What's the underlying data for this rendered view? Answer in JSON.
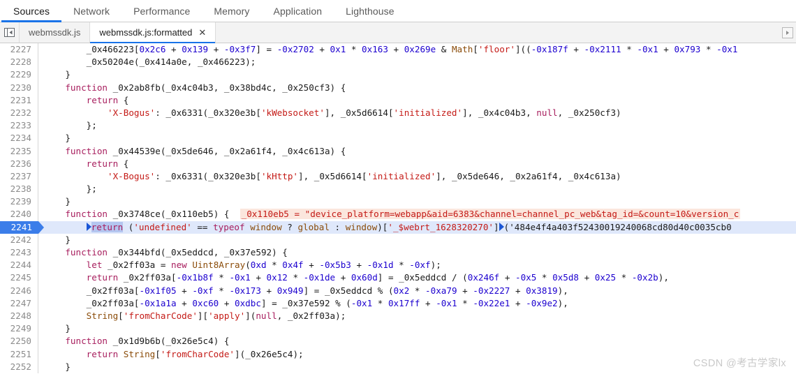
{
  "panel_tabs": [
    {
      "label": "Sources",
      "active": true
    },
    {
      "label": "Network",
      "active": false
    },
    {
      "label": "Performance",
      "active": false
    },
    {
      "label": "Memory",
      "active": false
    },
    {
      "label": "Application",
      "active": false
    },
    {
      "label": "Lighthouse",
      "active": false
    }
  ],
  "file_tabs": {
    "nav_toggle_icon": "panel-collapse-icon",
    "tabs": [
      {
        "label": "webmssdk.js",
        "active": false,
        "closable": false
      },
      {
        "label": "webmssdk.js:formatted",
        "active": true,
        "closable": true,
        "close_label": "✕"
      }
    ],
    "more_icon": "more-tabs-icon"
  },
  "editor": {
    "current_line": 2241,
    "inline_value_line": 2240,
    "inline_value_text": "_0x110eb5 = \"device_platform=webapp&aid=6383&channel=channel_pc_web&tag_id=&count=10&version_c",
    "lines": [
      {
        "n": 2227,
        "text": "        _0x466223[0x2c6 + 0x139 + -0x3f7] = -0x2702 + 0x1 * 0x163 + 0x269e & Math['floor']((-0x187f + -0x2111 * -0x1 + 0x793 * -0x1"
      },
      {
        "n": 2228,
        "text": "        _0x50204e(_0x414a0e, _0x466223);"
      },
      {
        "n": 2229,
        "text": "    }"
      },
      {
        "n": 2230,
        "text": "    function _0x2ab8fb(_0x4c04b3, _0x38bd4c, _0x250cf3) {"
      },
      {
        "n": 2231,
        "text": "        return {"
      },
      {
        "n": 2232,
        "text": "            'X-Bogus': _0x6331(_0x320e3b['kWebsocket'], _0x5d6614['initialized'], _0x4c04b3, null, _0x250cf3)"
      },
      {
        "n": 2233,
        "text": "        };"
      },
      {
        "n": 2234,
        "text": "    }"
      },
      {
        "n": 2235,
        "text": "    function _0x44539e(_0x5de646, _0x2a61f4, _0x4c613a) {"
      },
      {
        "n": 2236,
        "text": "        return {"
      },
      {
        "n": 2237,
        "text": "            'X-Bogus': _0x6331(_0x320e3b['kHttp'], _0x5d6614['initialized'], _0x5de646, _0x2a61f4, _0x4c613a)"
      },
      {
        "n": 2238,
        "text": "        };"
      },
      {
        "n": 2239,
        "text": "    }"
      },
      {
        "n": 2240,
        "text": "    function _0x3748ce(_0x110eb5) {"
      },
      {
        "n": 2241,
        "text": "        return ('undefined' == typeof window ? global : window)['_$webrt_1628320270']('484e4f4a403f52430019240068cd80d40c0035cb0"
      },
      {
        "n": 2242,
        "text": "    }"
      },
      {
        "n": 2243,
        "text": "    function _0x344bfd(_0x5eddcd, _0x37e592) {"
      },
      {
        "n": 2244,
        "text": "        let _0x2ff03a = new Uint8Array(0xd * 0x4f + -0x5b3 + -0x1d * -0xf);"
      },
      {
        "n": 2245,
        "text": "        return _0x2ff03a[-0x1b8f * -0x1 + 0x12 * -0x1de + 0x60d] = _0x5eddcd / (0x246f + -0x5 * 0x5d8 + 0x25 * -0x2b),"
      },
      {
        "n": 2246,
        "text": "        _0x2ff03a[-0x1f05 + -0xf * -0x173 + 0x949] = _0x5eddcd % (0x2 * -0xa79 + -0x2227 + 0x3819),"
      },
      {
        "n": 2247,
        "text": "        _0x2ff03a[-0x1a1a + 0xc60 + 0xdbc] = _0x37e592 % (-0x1 * 0x17ff + -0x1 * -0x22e1 + -0x9e2),"
      },
      {
        "n": 2248,
        "text": "        String['fromCharCode']['apply'](null, _0x2ff03a);"
      },
      {
        "n": 2249,
        "text": "    }"
      },
      {
        "n": 2250,
        "text": "    function _0x1d9b6b(_0x26e5c4) {"
      },
      {
        "n": 2251,
        "text": "        return String['fromCharCode'](_0x26e5c4);"
      },
      {
        "n": 2252,
        "text": "    }"
      }
    ]
  },
  "watermark": {
    "text": "CSDN @考古学家lx"
  },
  "colors": {
    "accent": "#1a73e8",
    "current_line_gutter": "#3b7de9",
    "current_line_bg": "#dfe8fb",
    "inline_value_bg": "#fbe6dd",
    "string": "#c41a16",
    "number": "#1c00cf",
    "keyword": "#a71d5d",
    "builtin": "#8a4b08"
  }
}
